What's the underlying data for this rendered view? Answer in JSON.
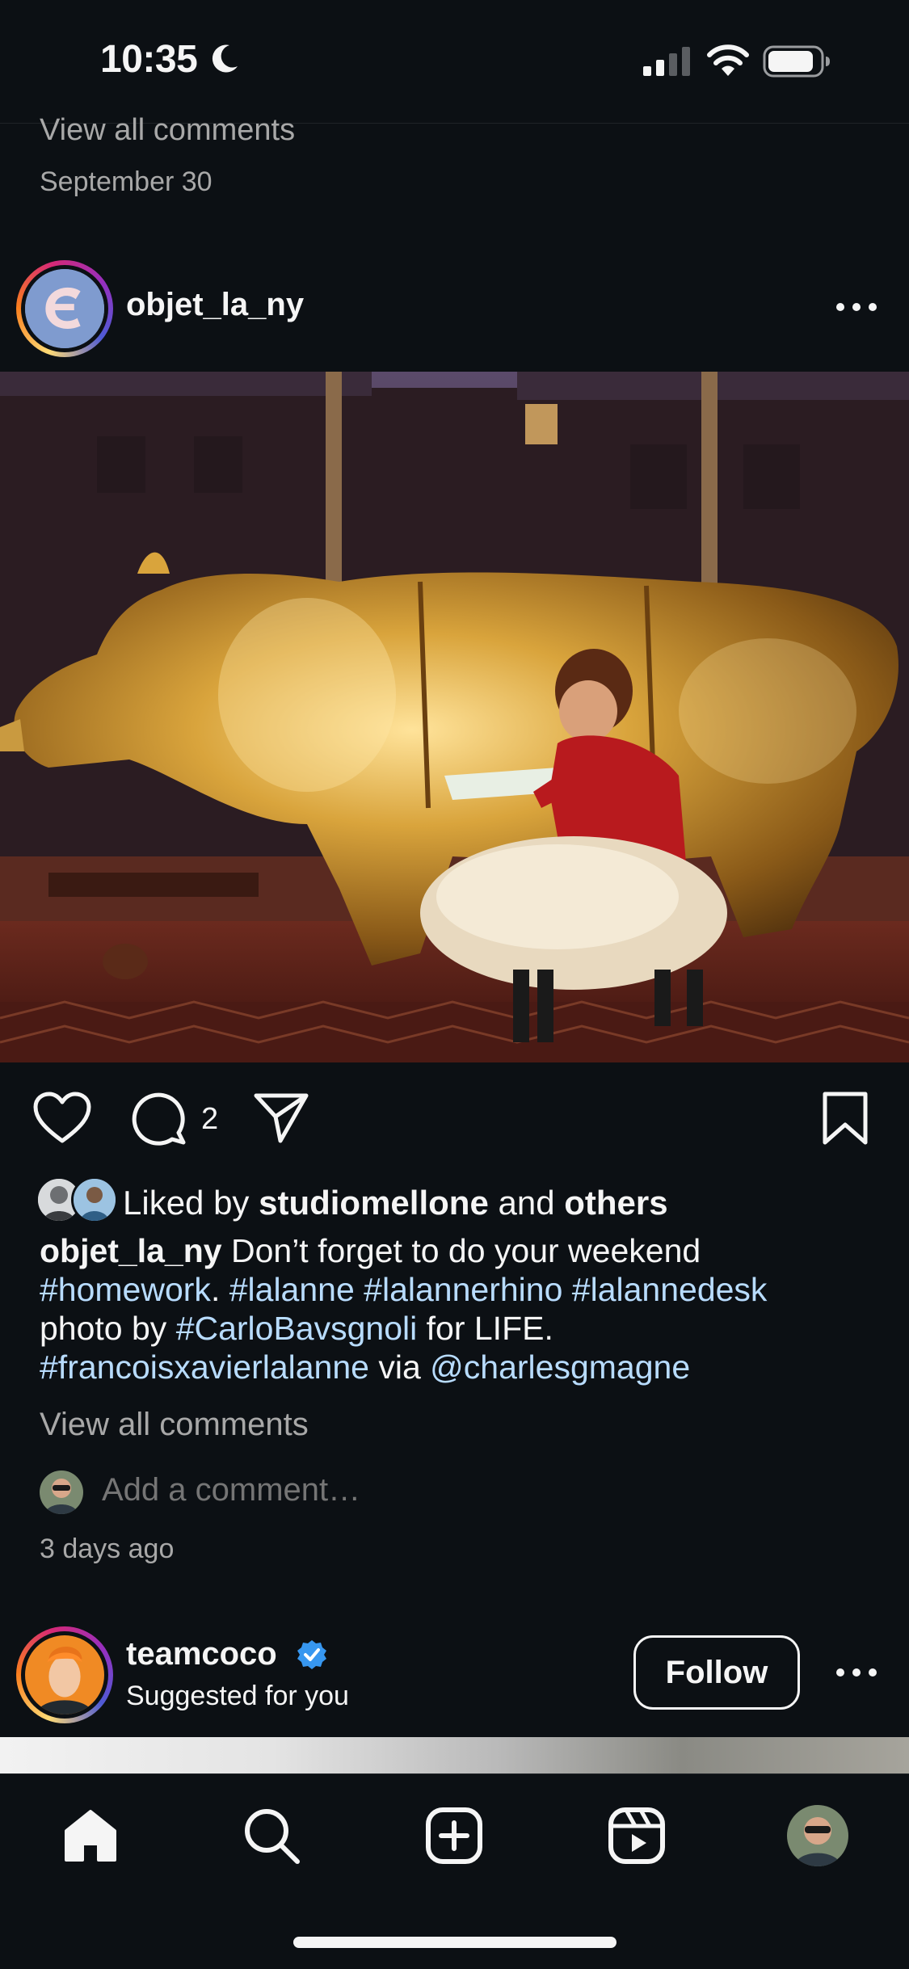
{
  "status_bar": {
    "time": "10:35",
    "icons": [
      "moon-icon",
      "cellular-signal-icon",
      "wifi-icon",
      "battery-icon"
    ]
  },
  "previous_post": {
    "view_all_comments": "View all comments",
    "date": "September 30"
  },
  "post": {
    "username": "objet_la_ny",
    "likes": {
      "prefix": "Liked by ",
      "user": "studiomellone",
      "conjunction": " and ",
      "others": "others"
    },
    "comment_count": "2",
    "caption": {
      "author": "objet_la_ny",
      "text_1": " Don’t forget to do your weekend ",
      "tag_homework": "#homework",
      "text_2": ". ",
      "tag_lalanne": "#lalanne",
      "tag_lalannerhino": "#lalannerhino",
      "tag_lalannedesk": "#lalannedesk",
      "text_3": "photo by ",
      "tag_carlo": "#CarloBavsgnoli",
      "text_4": " for LIFE.",
      "tag_fxl": "#francoisxavierlalanne",
      "text_5": " via ",
      "mention": "@charlesgmagne"
    },
    "view_all_comments": "View all comments",
    "add_comment_placeholder": "Add a comment…",
    "timestamp": "3 days ago"
  },
  "next_post": {
    "username": "teamcoco",
    "verified": true,
    "subtitle": "Suggested for you",
    "follow_label": "Follow"
  },
  "nav": {
    "items": [
      "home-icon",
      "search-icon",
      "create-icon",
      "reels-icon",
      "profile-avatar"
    ]
  },
  "colors": {
    "background": "#0c1014",
    "text": "#f5f5f5",
    "muted": "#a8a8a8",
    "hashtag": "#b8dcff",
    "verified": "#3797f0"
  }
}
